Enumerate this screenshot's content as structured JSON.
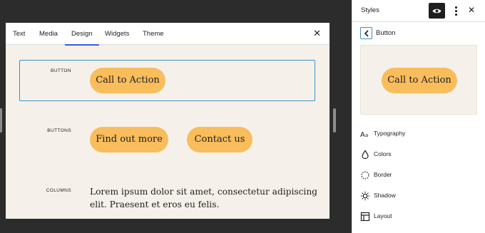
{
  "stylebook": {
    "tabs": [
      "Text",
      "Media",
      "Design",
      "Widgets",
      "Theme"
    ],
    "active_tab": "Design",
    "sections": {
      "button": {
        "label": "BUTTON",
        "items": [
          "Call to Action"
        ]
      },
      "buttons": {
        "label": "BUTTONS",
        "items": [
          "Find out more",
          "Contact us"
        ]
      },
      "columns": {
        "label": "COLUMNS",
        "text": "Lorem ipsum dolor sit amet, consectetur adipiscing elit. Praesent et eros eu felis."
      }
    }
  },
  "sidebar": {
    "title": "Styles",
    "panel_title": "Button",
    "preview_button": "Call to Action",
    "tools": [
      {
        "label": "Typography",
        "icon": "typography-icon"
      },
      {
        "label": "Colors",
        "icon": "droplet-icon"
      },
      {
        "label": "Border",
        "icon": "border-icon"
      },
      {
        "label": "Shadow",
        "icon": "shadow-icon"
      },
      {
        "label": "Layout",
        "icon": "layout-icon"
      }
    ]
  },
  "colors": {
    "canvas_background": "#f5f1ea",
    "button_background": "#f9bd5c",
    "accent": "#3858e9",
    "selection": "#3b8fc4"
  }
}
